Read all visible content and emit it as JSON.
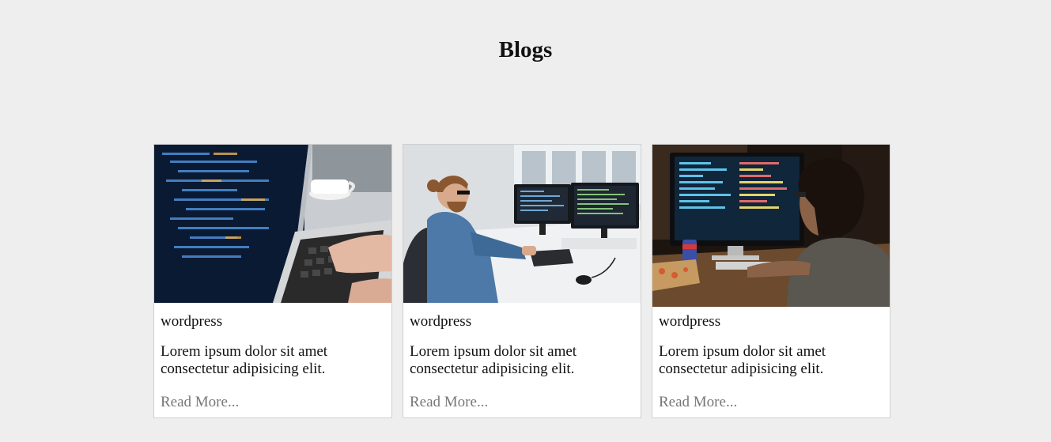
{
  "page": {
    "title": "Blogs"
  },
  "posts": [
    {
      "image": "laptop-code-photo",
      "category": "wordpress",
      "excerpt": "Lorem ipsum dolor sit amet consectetur adipisicing elit.",
      "link_label": "Read More..."
    },
    {
      "image": "developer-dual-monitors-photo",
      "category": "wordpress",
      "excerpt": "Lorem ipsum dolor sit amet consectetur adipisicing elit.",
      "link_label": "Read More..."
    },
    {
      "image": "programmer-night-desk-photo",
      "category": "wordpress",
      "excerpt": "Lorem ipsum dolor sit amet consectetur adipisicing elit.",
      "link_label": "Read More..."
    }
  ],
  "colors": {
    "background": "#eeeeee",
    "card": "#ffffff",
    "card_border": "#cfcfcf",
    "link": "#777777"
  }
}
